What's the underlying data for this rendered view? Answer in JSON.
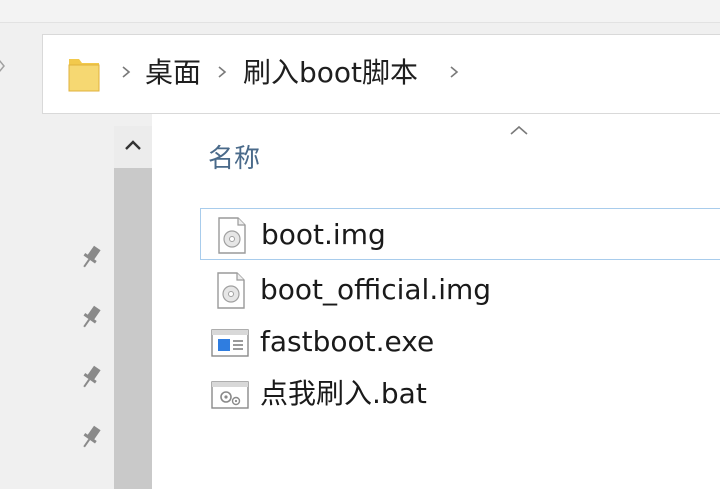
{
  "breadcrumb": {
    "items": [
      "桌面",
      "刷入boot脚本"
    ]
  },
  "file_list": {
    "column_header": "名称",
    "files": [
      {
        "name": "boot.img",
        "icon": "disk-image-icon",
        "selected": true
      },
      {
        "name": "boot_official.img",
        "icon": "disk-image-icon",
        "selected": false
      },
      {
        "name": "fastboot.exe",
        "icon": "application-icon",
        "selected": false
      },
      {
        "name": "点我刷入.bat",
        "icon": "batch-file-icon",
        "selected": false
      }
    ]
  },
  "colors": {
    "folder": "#f2c94c",
    "selection_border": "#a8ccec",
    "header_text": "#4a6a8a"
  }
}
